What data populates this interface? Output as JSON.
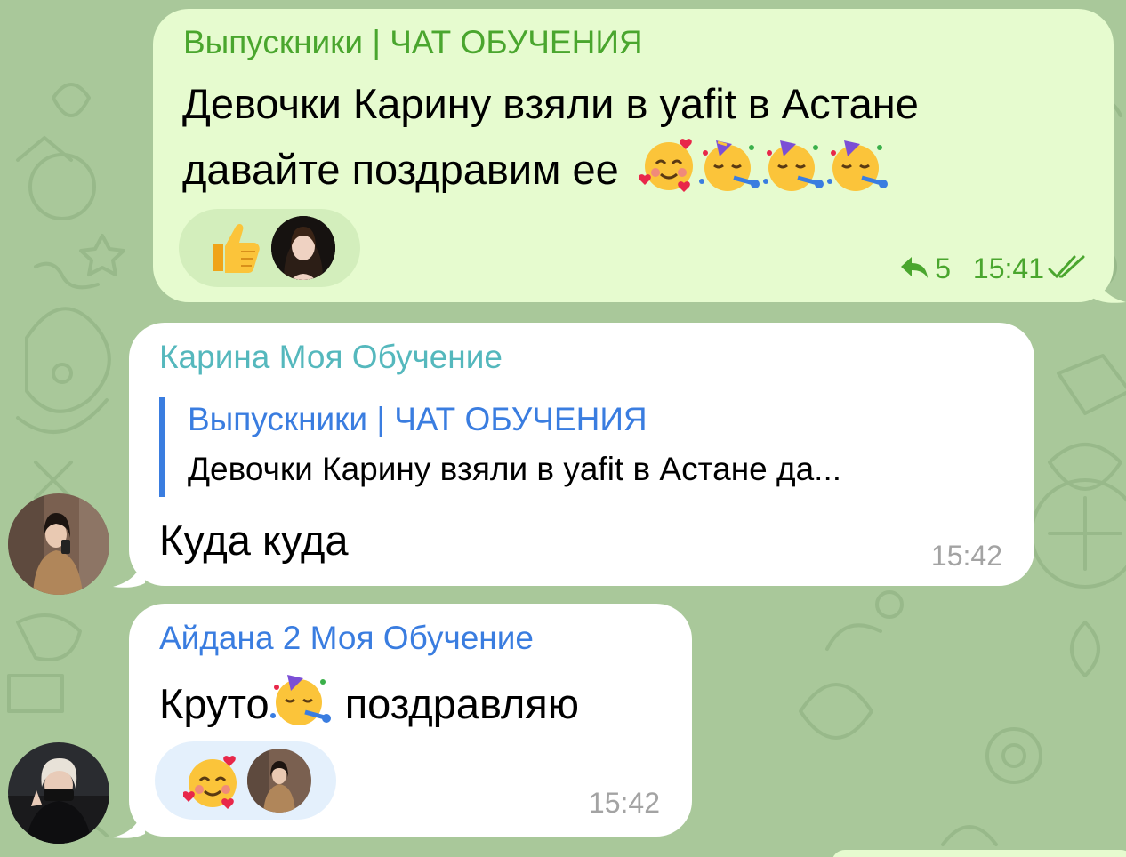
{
  "colors": {
    "chat_background": "#a9c89a",
    "outgoing_bubble": "#e6fbcf",
    "incoming_bubble": "#ffffff",
    "forward_sender": "#4aa62e",
    "outgoing_meta": "#4aa62e",
    "incoming_meta": "#a3a3a3",
    "sender_karina": "#55b8bd",
    "sender_aidana": "#3a7de0",
    "quote_accent": "#3a7de0"
  },
  "messages": [
    {
      "forwarded_from": "Выпускники | ЧАТ ОБУЧЕНИЯ",
      "text_line1": "Девочки Карину взяли в yafit в Астане",
      "text_line2": "давайте поздравим ее",
      "text_emoji": [
        "smiling-face-with-hearts",
        "partying-face",
        "partying-face",
        "partying-face"
      ],
      "reactions": [
        "thumbs-up",
        "user-photo"
      ],
      "replies_count": "5",
      "time": "15:41",
      "status": "read"
    },
    {
      "sender": "Карина Моя Обучение",
      "quote_author": "Выпускники | ЧАТ ОБУЧЕНИЯ",
      "quote_text": "Девочки Карину взяли в yafit в Астане да...",
      "text": "Куда куда",
      "time": "15:42"
    },
    {
      "sender": "Айдана 2 Моя Обучение",
      "text_before": "Круто",
      "text_emoji": "partying-face",
      "text_after": " поздравляю",
      "reactions": [
        "smiling-face-with-hearts",
        "user-photo"
      ],
      "time": "15:42"
    }
  ]
}
